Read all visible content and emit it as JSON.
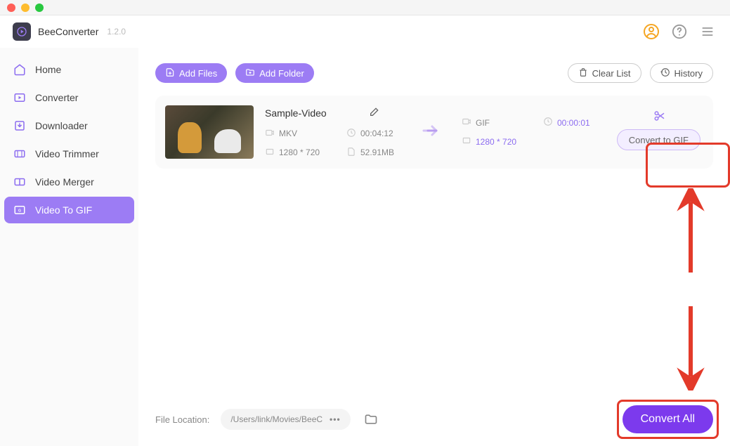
{
  "app": {
    "name": "BeeConverter",
    "version": "1.2.0"
  },
  "sidebar": {
    "items": [
      {
        "id": "home",
        "label": "Home"
      },
      {
        "id": "converter",
        "label": "Converter"
      },
      {
        "id": "downloader",
        "label": "Downloader"
      },
      {
        "id": "video-trimmer",
        "label": "Video Trimmer"
      },
      {
        "id": "video-merger",
        "label": "Video Merger"
      },
      {
        "id": "video-to-gif",
        "label": "Video To GIF"
      }
    ],
    "active_id": "video-to-gif"
  },
  "toolbar": {
    "add_files": "Add Files",
    "add_folder": "Add Folder",
    "clear_list": "Clear List",
    "history": "History"
  },
  "file": {
    "title": "Sample-Video",
    "source": {
      "format": "MKV",
      "duration": "00:04:12",
      "resolution": "1280 * 720",
      "size": "52.91MB"
    },
    "target": {
      "format": "GIF",
      "duration": "00:00:01",
      "resolution": "1280 * 720"
    },
    "convert_label": "Convert to GIF"
  },
  "footer": {
    "label": "File Location:",
    "path": "/Users/link/Movies/BeeC",
    "convert_all": "Convert All"
  },
  "colors": {
    "accent": "#9c7cf4",
    "accent_dark": "#7c3aed",
    "highlight": "#e33a2a"
  }
}
